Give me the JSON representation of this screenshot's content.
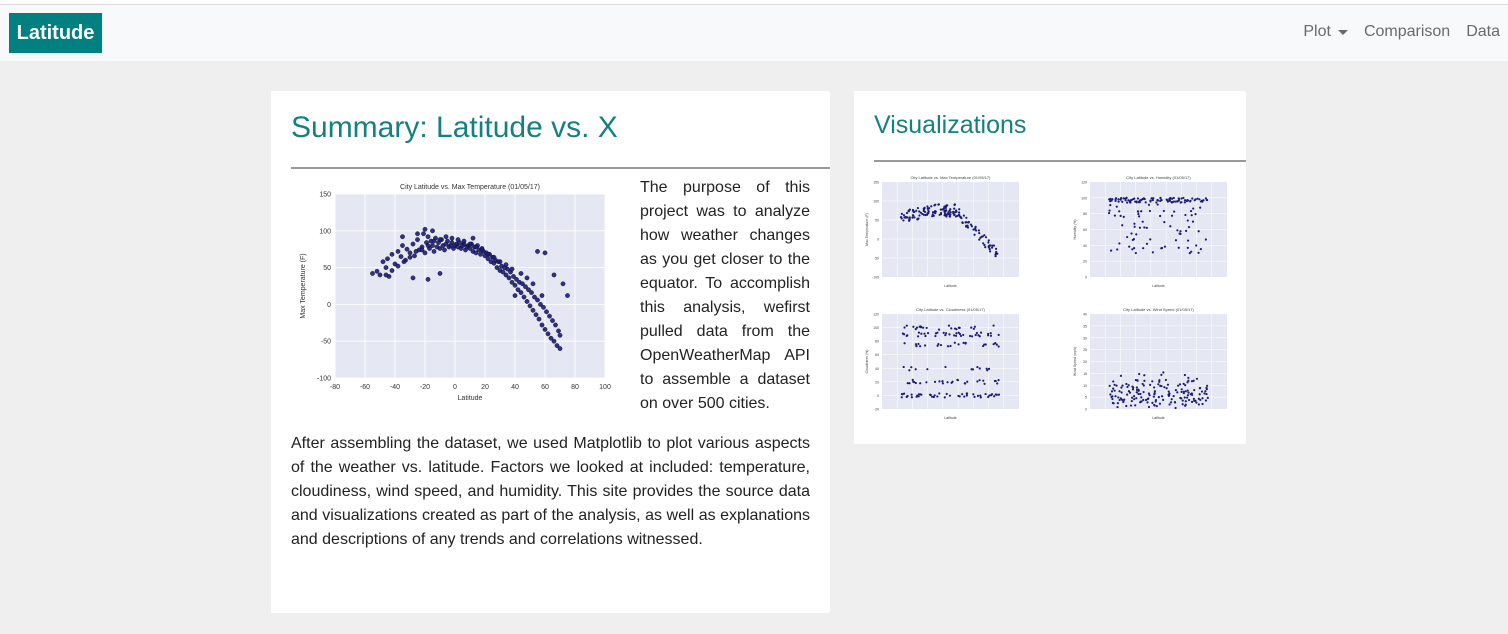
{
  "navbar": {
    "brand": "Latitude",
    "links": [
      {
        "label": "Plot",
        "dropdown": true
      },
      {
        "label": "Comparison",
        "dropdown": false
      },
      {
        "label": "Data",
        "dropdown": false
      }
    ]
  },
  "colors": {
    "accent": "#008080",
    "title": "#148080",
    "point": "#1c1c78",
    "plot_bg": "#e5e8f2"
  },
  "summary": {
    "title": "Summary: Latitude vs. X",
    "paragraph1": "The purpose of this project was to analyze how weather changes as you get closer to the equator. To accomplish this analysis, wefirst pulled data from the OpenWeatherMap API to assemble a dataset on over 500 cities.",
    "paragraph2": "After assembling the dataset, we used Matplotlib to plot various aspects of the weather vs. latitude. Factors we looked at included: temperature, cloudiness, wind speed, and humidity. This site provides the source data and visualizations created as part of the analysis, as well as explanations and descriptions of any trends and correlations witnessed."
  },
  "visualizations": {
    "title": "Visualizations",
    "thumbnails": [
      {
        "title": "City Latitude vs. Max Temperature (01/05/17)",
        "ylabel": "Max Temperature (F)",
        "xlabel": "Latitude",
        "kind": "temperature",
        "yticks": [
          "150",
          "100",
          "50",
          "0",
          "-50",
          "-100"
        ]
      },
      {
        "title": "City Latitude vs. Humidity (01/05/17)",
        "ylabel": "Humidity (%)",
        "xlabel": "Latitude",
        "kind": "humidity",
        "yticks": [
          "120",
          "100",
          "80",
          "60",
          "40",
          "20",
          "0"
        ]
      },
      {
        "title": "City Latitude vs. Cloudiness (01/05/17)",
        "ylabel": "Cloudiness (%)",
        "xlabel": "Latitude",
        "kind": "cloudiness",
        "yticks": [
          "120",
          "100",
          "80",
          "60",
          "40",
          "20",
          "0",
          "-20"
        ]
      },
      {
        "title": "City Latitude vs. Wind Speed (01/05/17)",
        "ylabel": "Wind Speed (mph)",
        "xlabel": "Latitude",
        "kind": "wind",
        "yticks": [
          "40",
          "35",
          "30",
          "25",
          "20",
          "15",
          "10",
          "5",
          "0"
        ]
      }
    ]
  },
  "chart_data": {
    "type": "scatter",
    "title": "City Latitude vs. Max Temperature (01/05/17)",
    "xlabel": "Latitude",
    "ylabel": "Max Temperature (F)",
    "xlim": [
      -80,
      100
    ],
    "ylim": [
      -100,
      150
    ],
    "xticks": [
      -80,
      -60,
      -40,
      -20,
      0,
      20,
      40,
      60,
      80,
      100
    ],
    "yticks": [
      150,
      100,
      50,
      0,
      -50,
      -100
    ],
    "grid": true,
    "series": [
      {
        "points": [
          [
            -55,
            42
          ],
          [
            -52,
            45
          ],
          [
            -50,
            40
          ],
          [
            -48,
            58
          ],
          [
            -46,
            50
          ],
          [
            -45,
            62
          ],
          [
            -44,
            38
          ],
          [
            -42,
            68
          ],
          [
            -40,
            55
          ],
          [
            -38,
            72
          ],
          [
            -36,
            65
          ],
          [
            -35,
            80
          ],
          [
            -33,
            60
          ],
          [
            -32,
            75
          ],
          [
            -30,
            70
          ],
          [
            -28,
            82
          ],
          [
            -27,
            66
          ],
          [
            -25,
            88
          ],
          [
            -24,
            74
          ],
          [
            -22,
            78
          ],
          [
            -21,
            96
          ],
          [
            -20,
            70
          ],
          [
            -19,
            84
          ],
          [
            -18,
            92
          ],
          [
            -17,
            76
          ],
          [
            -16,
            86
          ],
          [
            -15,
            80
          ],
          [
            -14,
            72
          ],
          [
            -13,
            90
          ],
          [
            -12,
            78
          ],
          [
            -11,
            84
          ],
          [
            -10,
            76
          ],
          [
            -9,
            88
          ],
          [
            -8,
            80
          ],
          [
            -7,
            74
          ],
          [
            -6,
            82
          ],
          [
            -5,
            86
          ],
          [
            -4,
            78
          ],
          [
            -3,
            80
          ],
          [
            -2,
            84
          ],
          [
            -1,
            76
          ],
          [
            0,
            80
          ],
          [
            1,
            82
          ],
          [
            2,
            78
          ],
          [
            3,
            84
          ],
          [
            4,
            76
          ],
          [
            5,
            80
          ],
          [
            6,
            82
          ],
          [
            7,
            74
          ],
          [
            8,
            78
          ],
          [
            9,
            80
          ],
          [
            10,
            76
          ],
          [
            11,
            82
          ],
          [
            12,
            72
          ],
          [
            13,
            78
          ],
          [
            14,
            70
          ],
          [
            15,
            80
          ],
          [
            16,
            74
          ],
          [
            17,
            68
          ],
          [
            18,
            76
          ],
          [
            19,
            72
          ],
          [
            20,
            66
          ],
          [
            21,
            70
          ],
          [
            22,
            62
          ],
          [
            23,
            68
          ],
          [
            24,
            58
          ],
          [
            25,
            64
          ],
          [
            26,
            56
          ],
          [
            27,
            60
          ],
          [
            28,
            50
          ],
          [
            29,
            58
          ],
          [
            30,
            46
          ],
          [
            31,
            52
          ],
          [
            32,
            44
          ],
          [
            33,
            50
          ],
          [
            34,
            40
          ],
          [
            35,
            48
          ],
          [
            36,
            36
          ],
          [
            37,
            44
          ],
          [
            38,
            30
          ],
          [
            39,
            38
          ],
          [
            40,
            26
          ],
          [
            41,
            34
          ],
          [
            42,
            20
          ],
          [
            43,
            30
          ],
          [
            44,
            16
          ],
          [
            45,
            28
          ],
          [
            46,
            10
          ],
          [
            47,
            24
          ],
          [
            48,
            4
          ],
          [
            49,
            20
          ],
          [
            50,
            -2
          ],
          [
            51,
            16
          ],
          [
            52,
            -8
          ],
          [
            53,
            10
          ],
          [
            54,
            -14
          ],
          [
            55,
            6
          ],
          [
            56,
            -20
          ],
          [
            57,
            0
          ],
          [
            58,
            -28
          ],
          [
            59,
            -4
          ],
          [
            60,
            -34
          ],
          [
            61,
            -10
          ],
          [
            62,
            -40
          ],
          [
            63,
            -16
          ],
          [
            64,
            -46
          ],
          [
            65,
            -22
          ],
          [
            66,
            -50
          ],
          [
            67,
            -28
          ],
          [
            68,
            -56
          ],
          [
            69,
            -36
          ],
          [
            70,
            -60
          ],
          [
            55,
            72
          ],
          [
            60,
            70
          ],
          [
            66,
            40
          ],
          [
            72,
            28
          ],
          [
            75,
            12
          ],
          [
            70,
            -42
          ],
          [
            52,
            28
          ],
          [
            48,
            36
          ],
          [
            44,
            42
          ],
          [
            38,
            48
          ],
          [
            34,
            54
          ],
          [
            30,
            58
          ],
          [
            26,
            64
          ],
          [
            22,
            68
          ],
          [
            18,
            74
          ],
          [
            14,
            78
          ],
          [
            10,
            82
          ],
          [
            6,
            86
          ],
          [
            2,
            88
          ],
          [
            -2,
            90
          ],
          [
            -6,
            92
          ],
          [
            -10,
            88
          ],
          [
            -14,
            86
          ],
          [
            -18,
            80
          ],
          [
            -22,
            74
          ],
          [
            -26,
            72
          ],
          [
            -30,
            64
          ],
          [
            -34,
            58
          ],
          [
            -38,
            52
          ],
          [
            -42,
            46
          ],
          [
            -46,
            40
          ],
          [
            -20,
            102
          ],
          [
            -15,
            100
          ],
          [
            -25,
            96
          ],
          [
            -35,
            92
          ],
          [
            -28,
            36
          ],
          [
            -18,
            34
          ],
          [
            -10,
            42
          ],
          [
            12,
            90
          ],
          [
            40,
            12
          ],
          [
            58,
            12
          ]
        ]
      }
    ]
  }
}
